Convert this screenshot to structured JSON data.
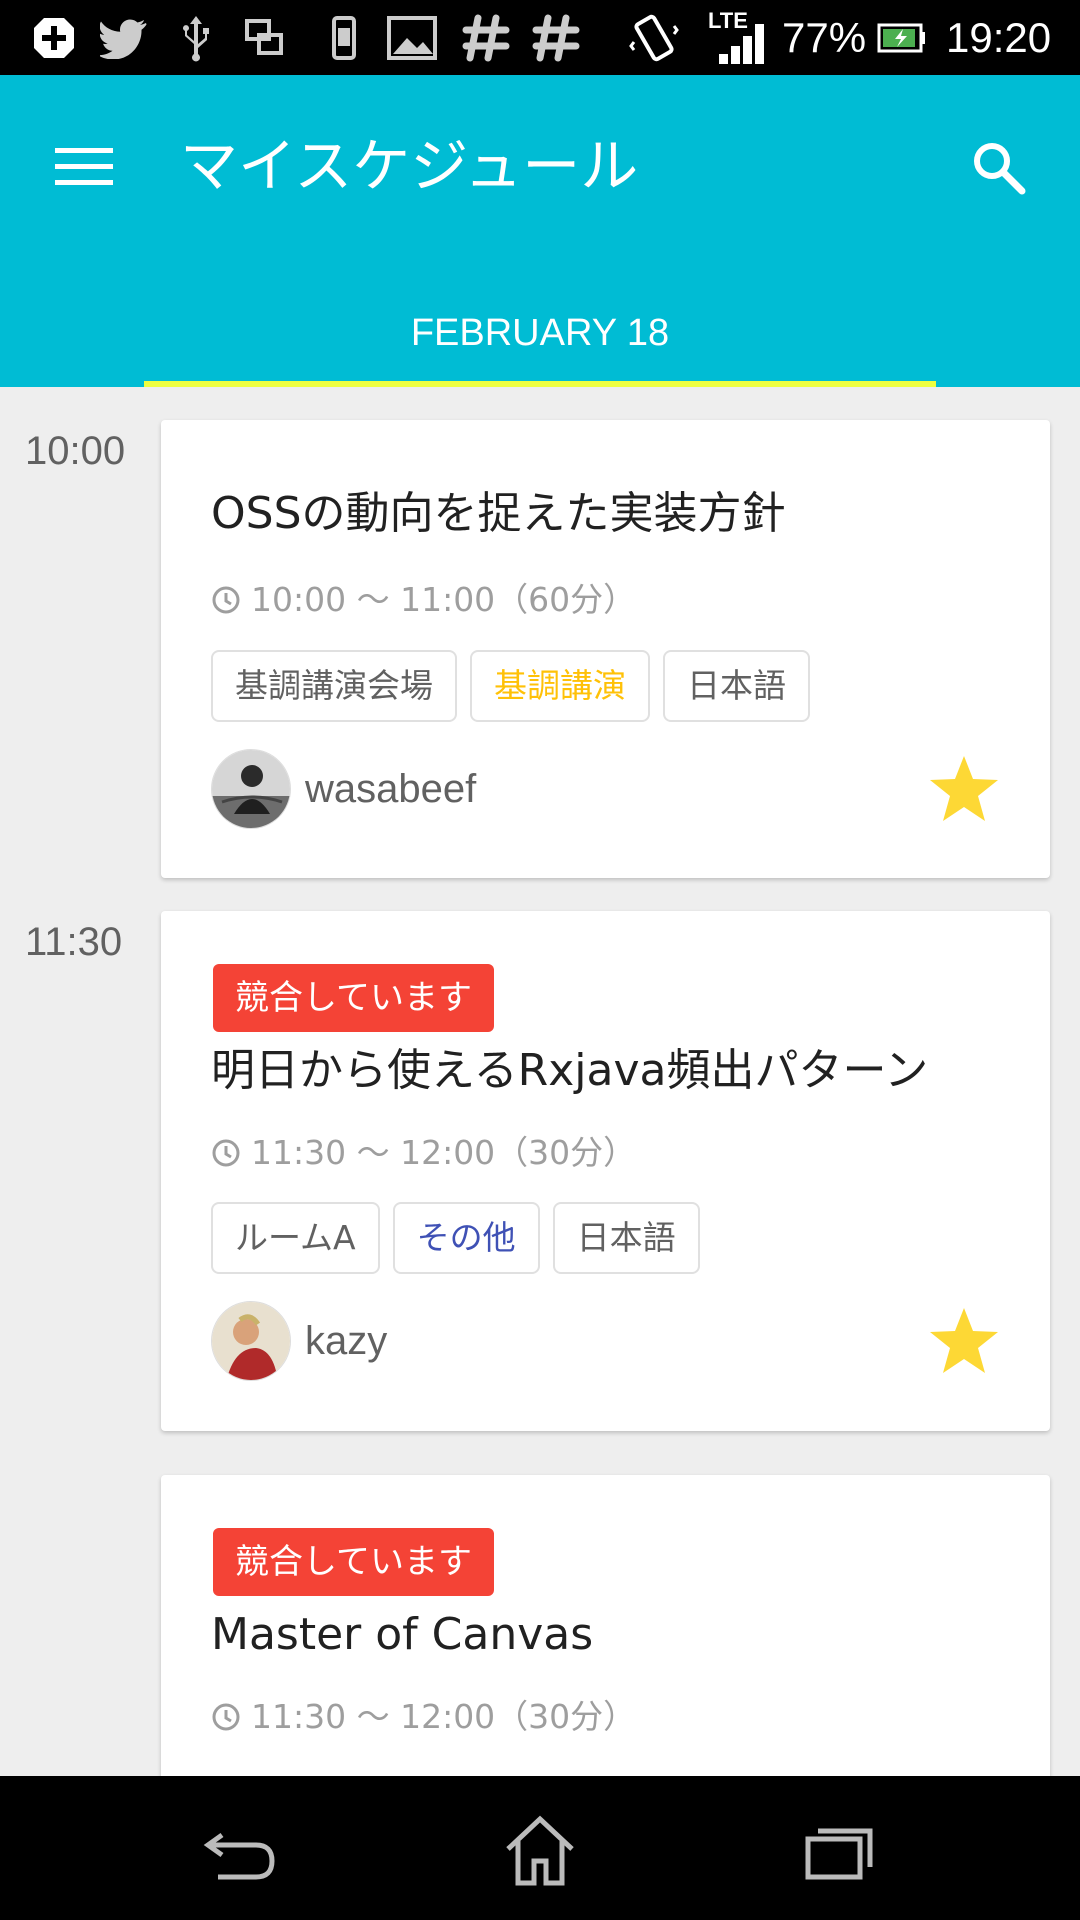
{
  "status_bar": {
    "battery": "77%",
    "time": "19:20",
    "network": "LTE"
  },
  "toolbar": {
    "title": "マイスケジュール",
    "tab": "FEBRUARY 18",
    "color": "#00bcd4",
    "indicator_color": "#eeff41"
  },
  "schedule": [
    {
      "time_label": "10:00",
      "conflict": "",
      "title": "OSSの動向を捉えた実装方針",
      "time": "10:00 〜 11:00（60分）",
      "tags": [
        "基調講演会場",
        "基調講演",
        "日本語"
      ],
      "speaker": "wasabeef",
      "starred": true
    },
    {
      "time_label": "11:30",
      "conflict": "競合しています",
      "title": "明日から使えるRxjava頻出パターン",
      "time": "11:30 〜 12:00（30分）",
      "tags": [
        "ルームA",
        "その他",
        "日本語"
      ],
      "speaker": "kazy",
      "starred": true
    },
    {
      "time_label": "",
      "conflict": "競合しています",
      "title": "Master of Canvas",
      "time": "11:30 〜 12:00（30分）",
      "tags": [],
      "speaker": "",
      "starred": false
    }
  ],
  "icons": {
    "menu": "menu-icon",
    "search": "search-icon",
    "star": "star-icon",
    "clock": "clock-icon",
    "back": "back-icon",
    "home": "home-icon",
    "recents": "recents-icon"
  },
  "colors": {
    "conflict": "#f44336",
    "star": "#fdd835",
    "keynote_tag": "#ffc107",
    "other_tag": "#3f51b5"
  }
}
